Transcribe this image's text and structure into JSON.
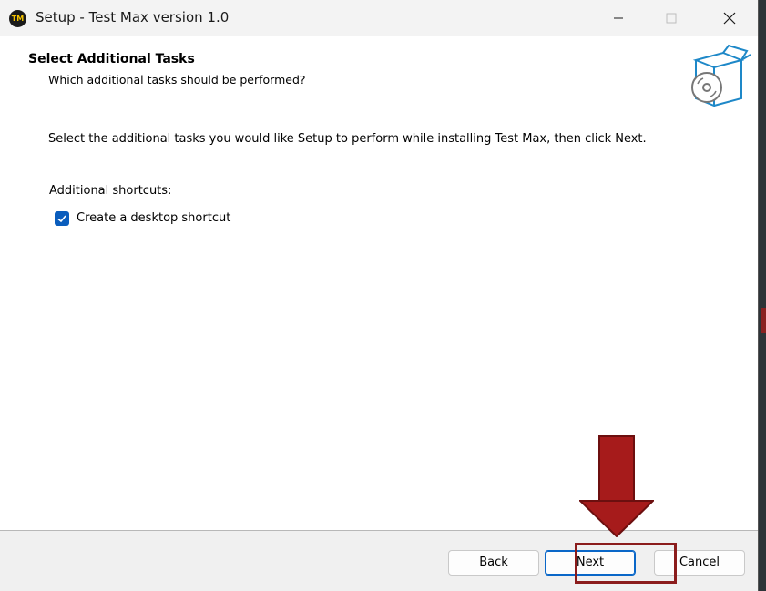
{
  "window": {
    "title": "Setup - Test Max version 1.0",
    "app_icon_text": "TM"
  },
  "header": {
    "title": "Select Additional Tasks",
    "subtitle": "Which additional tasks should be performed?",
    "icon": "software-box-icon"
  },
  "main": {
    "intro": "Select the additional tasks you would like Setup to perform while installing Test Max, then click Next.",
    "group_label": "Additional shortcuts:",
    "tasks": [
      {
        "label": "Create a desktop shortcut",
        "checked": true
      }
    ]
  },
  "buttons": {
    "back": "Back",
    "next": "Next",
    "cancel": "Cancel"
  },
  "annotation": {
    "type": "arrow-and-box",
    "color": "#a61b1b",
    "target": "next-button"
  },
  "colors": {
    "accent": "#0a5dbd",
    "annotation": "#a61b1b"
  }
}
